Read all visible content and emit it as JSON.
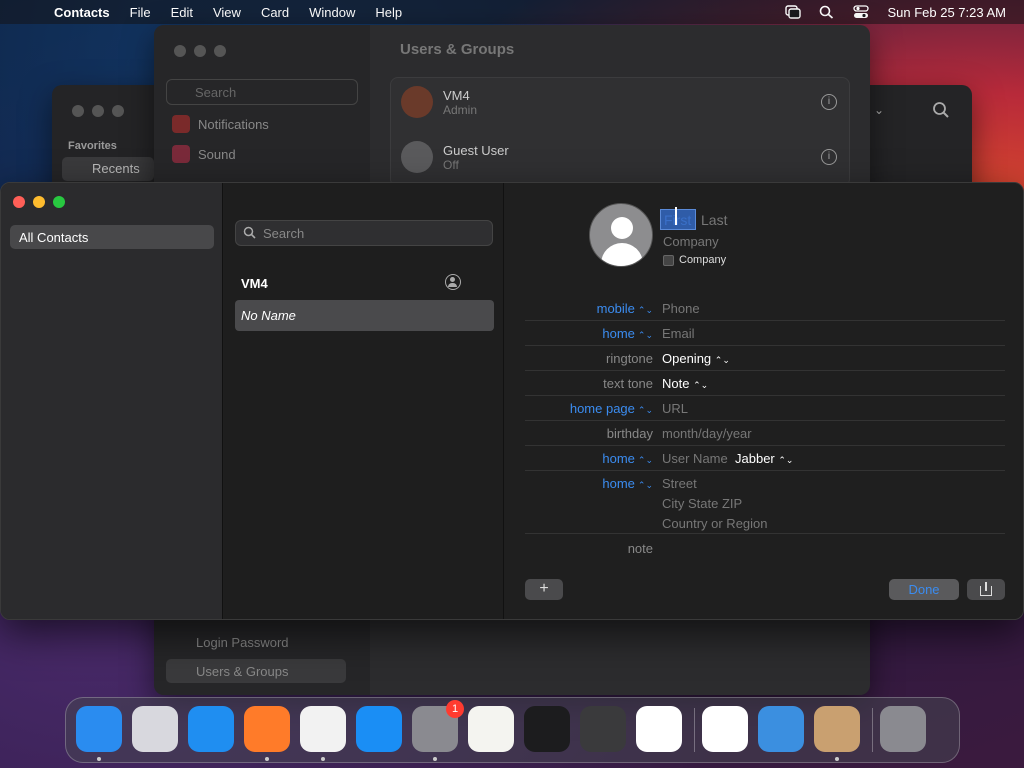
{
  "menubar": {
    "app_name": "Contacts",
    "menus": [
      "File",
      "Edit",
      "View",
      "Card",
      "Window",
      "Help"
    ],
    "datetime": "Sun Feb 25  7:23 AM"
  },
  "finder": {
    "favorites_label": "Favorites",
    "recents_label": "Recents"
  },
  "system_settings": {
    "search_placeholder": "Search",
    "title": "Users & Groups",
    "sidebar_items": [
      "Notifications",
      "Sound"
    ],
    "bottom_items": [
      "Login Password",
      "Users & Groups"
    ],
    "users": [
      {
        "name": "VM4",
        "role": "Admin"
      },
      {
        "name": "Guest User",
        "role": "Off"
      }
    ]
  },
  "contacts": {
    "sidebar": {
      "all_contacts": "All Contacts"
    },
    "list": {
      "search_placeholder": "Search",
      "group_name": "VM4",
      "selected_item": "No Name"
    },
    "card": {
      "first_placeholder": "First",
      "last_placeholder": "Last",
      "company_placeholder": "Company",
      "company_checkbox_label": "Company",
      "fields": {
        "mobile_label": "mobile",
        "phone_placeholder": "Phone",
        "home_email_label": "home",
        "email_placeholder": "Email",
        "ringtone_label": "ringtone",
        "ringtone_value": "Opening",
        "text_tone_label": "text tone",
        "text_tone_value": "Note",
        "home_page_label": "home page",
        "url_placeholder": "URL",
        "birthday_label": "birthday",
        "birthday_placeholder": "month/day/year",
        "im_label": "home",
        "username_placeholder": "User Name",
        "im_service": "Jabber",
        "address_label": "home",
        "street_placeholder": "Street",
        "city_placeholder": "City  State  ZIP",
        "country_placeholder": "Country or Region",
        "note_label": "note"
      },
      "add_button": "+",
      "done_button": "Done"
    }
  },
  "dock": {
    "apps": [
      {
        "name": "Finder",
        "icon": "finder-icon",
        "color": "#2a8cf0",
        "running": true
      },
      {
        "name": "Launchpad",
        "icon": "launchpad-icon",
        "color": "#d8d8de",
        "running": false
      },
      {
        "name": "Safari",
        "icon": "safari-icon",
        "color": "#1f8ef1",
        "running": false
      },
      {
        "name": "Firefox",
        "icon": "firefox-icon",
        "color": "#ff7b29",
        "running": true
      },
      {
        "name": "Chrome",
        "icon": "chrome-icon",
        "color": "#f2f2f2",
        "running": true
      },
      {
        "name": "App Store",
        "icon": "app-store-icon",
        "color": "#1a8ef5",
        "running": false
      },
      {
        "name": "System Settings",
        "icon": "gear-icon",
        "color": "#8a8a90",
        "running": true,
        "badge": "1"
      },
      {
        "name": "TextEdit",
        "icon": "textedit-icon",
        "color": "#f4f4f0",
        "running": false
      },
      {
        "name": "Terminal",
        "icon": "terminal-icon",
        "color": "#1c1c1e",
        "running": false
      },
      {
        "name": "GarageBand",
        "icon": "guitar-icon",
        "color": "#3a3a3c",
        "running": false
      },
      {
        "name": "Visual Studio Code",
        "icon": "vscode-icon",
        "color": "#ffffff",
        "running": false
      },
      {
        "name": "Visual Studio",
        "icon": "visual-studio-icon",
        "color": "#ffffff",
        "running": false
      },
      {
        "name": "Weather",
        "icon": "weather-icon",
        "color": "#3b8fe0",
        "running": false
      },
      {
        "name": "Contacts",
        "icon": "contacts-icon",
        "color": "#c9a070",
        "running": true
      },
      {
        "name": "Trash",
        "icon": "trash-icon",
        "color": "#8a8a90",
        "running": false
      }
    ]
  }
}
